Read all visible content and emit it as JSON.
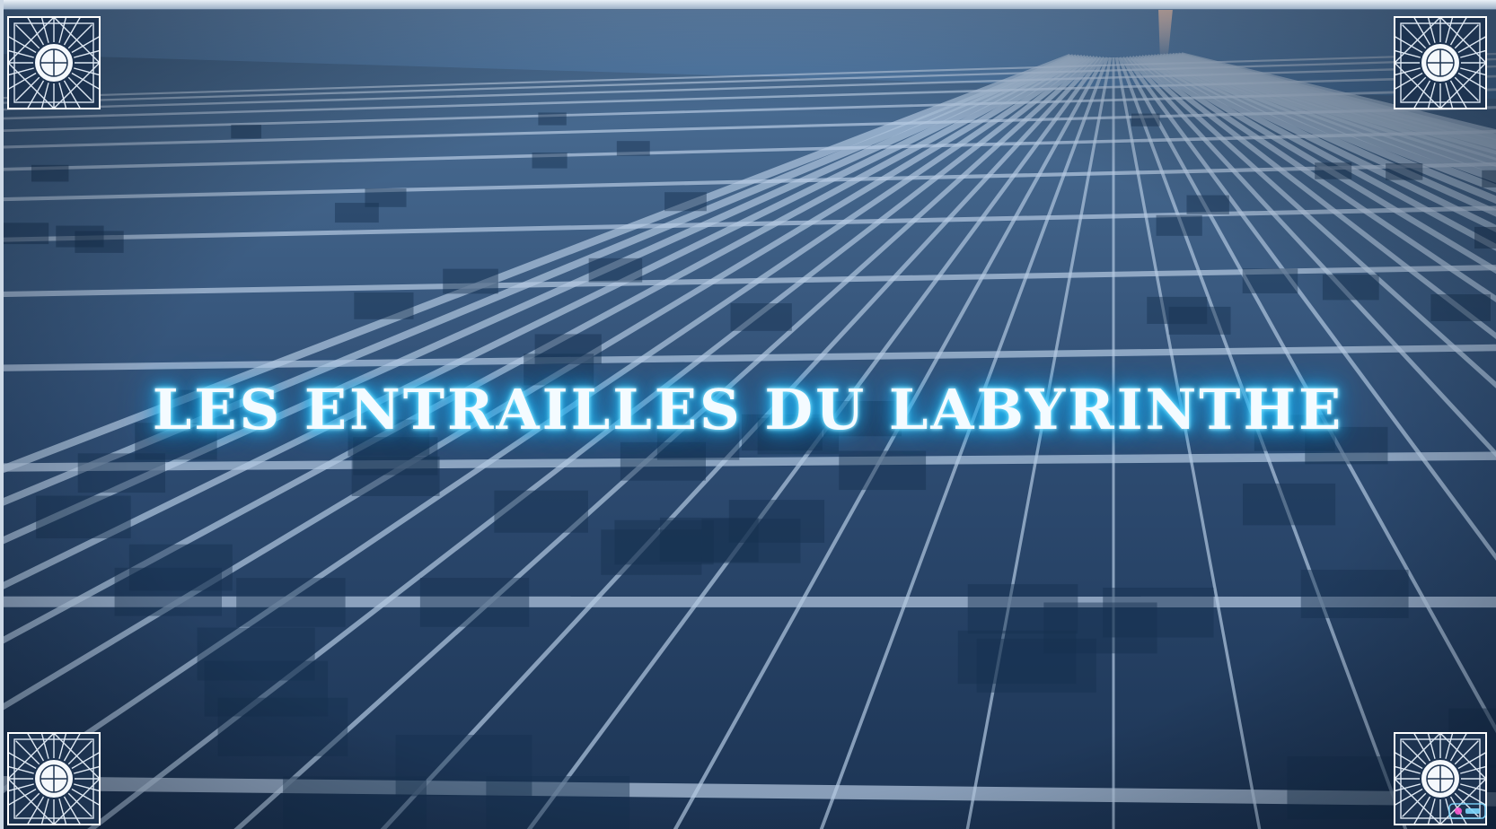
{
  "title": "LES ENTRAILLES DU LABYRINTHE",
  "colors": {
    "sky": "#4f79a6",
    "maze_wall": "#8fa9c8",
    "maze_shadow": "#1c3454",
    "glow": "#29c8ff"
  },
  "icons": {
    "corners": "ornamental-compass-icon",
    "watermark": "channel-logo-icon"
  }
}
